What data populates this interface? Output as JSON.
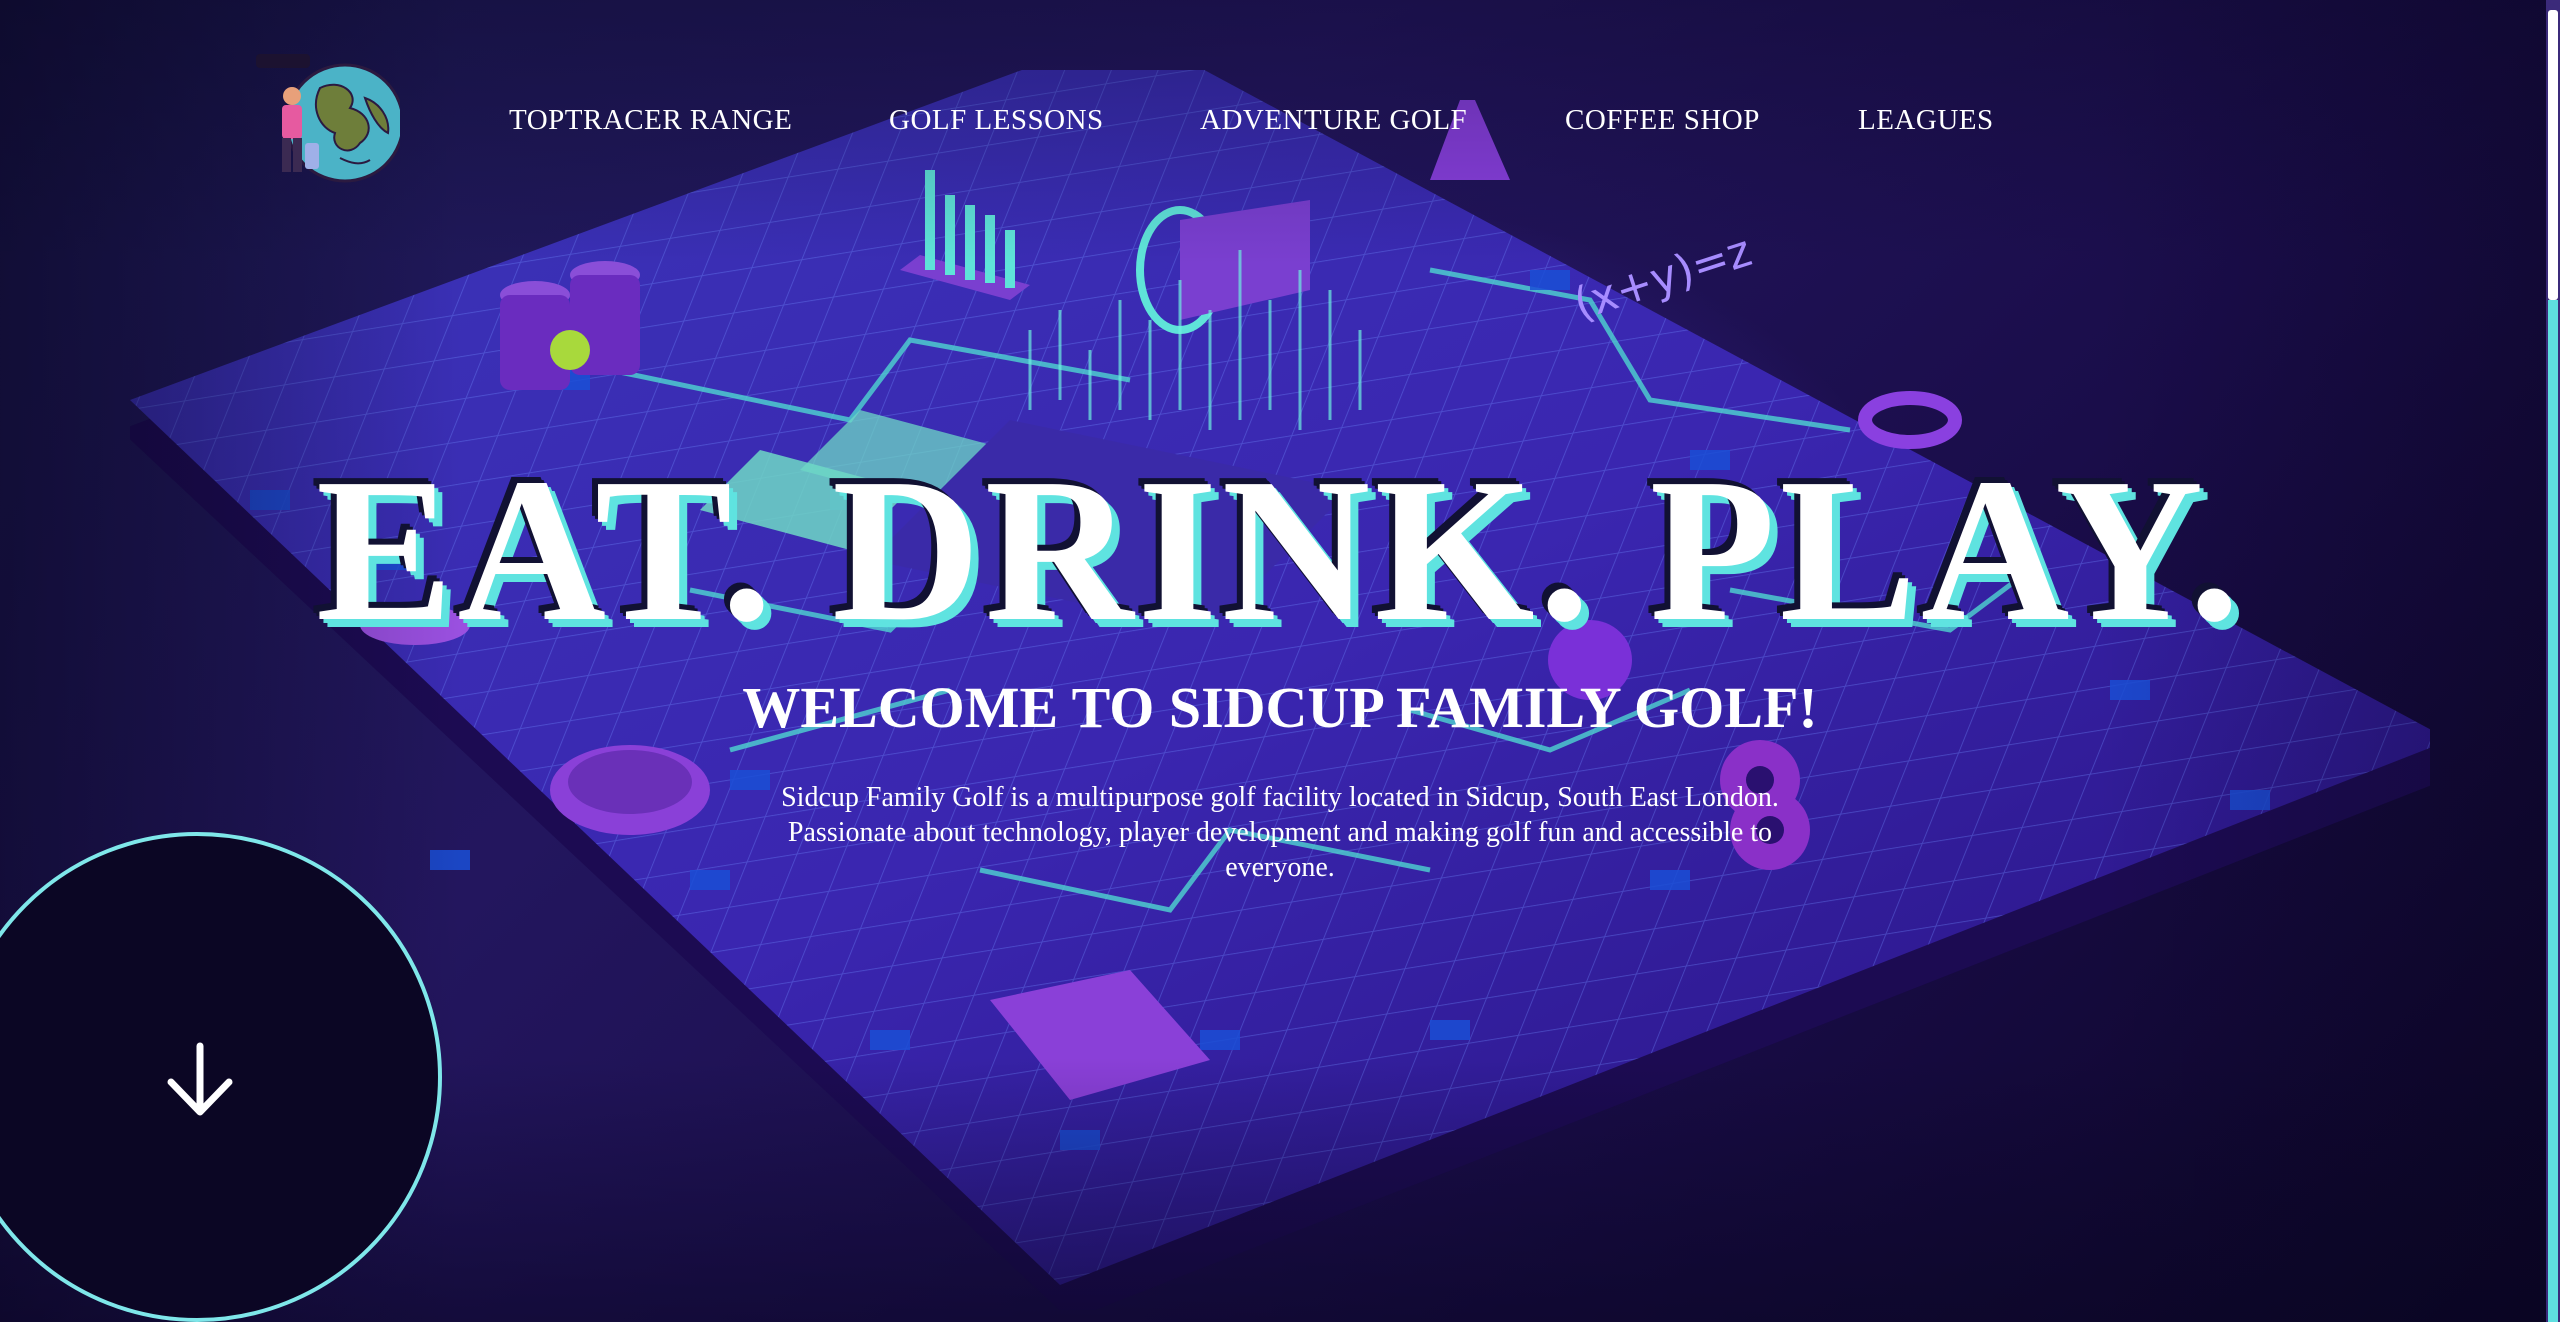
{
  "header": {
    "logo_name": "globe-golfer-logo",
    "nav": [
      {
        "label": "TOPTRACER RANGE"
      },
      {
        "label": "GOLF LESSONS"
      },
      {
        "label": "ADVENTURE GOLF"
      },
      {
        "label": "COFFEE SHOP"
      },
      {
        "label": "LEAGUES"
      }
    ]
  },
  "hero": {
    "title": "EAT. DRINK. PLAY.",
    "subtitle": "WELCOME TO SIDCUP FAMILY GOLF!",
    "description": "Sidcup Family Golf is a multipurpose golf facility located in Sidcup, South East London. Passionate about technology, player development and making golf fun and accessible to everyone.",
    "scroll_icon": "arrow-down-icon"
  },
  "colors": {
    "accent_cyan": "#5fe3e0",
    "background_purple": "#23165e",
    "text": "#ffffff"
  }
}
